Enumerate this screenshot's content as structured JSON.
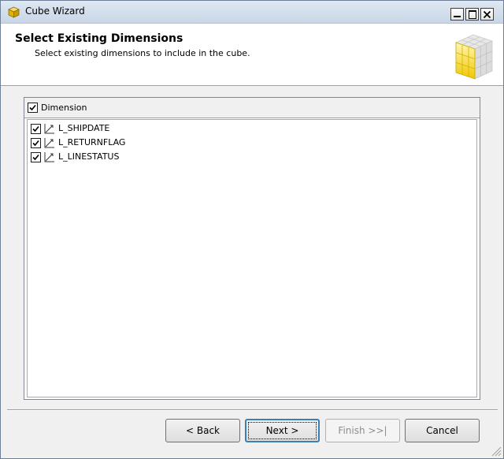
{
  "window": {
    "title": "Cube Wizard"
  },
  "header": {
    "title": "Select Existing Dimensions",
    "subtitle": "Select existing dimensions to include in the cube."
  },
  "list": {
    "column_header": "Dimension",
    "header_checked": true,
    "items": [
      {
        "label": "L_SHIPDATE",
        "checked": true,
        "icon": "dimension-icon"
      },
      {
        "label": "L_RETURNFLAG",
        "checked": true,
        "icon": "dimension-icon"
      },
      {
        "label": "L_LINESTATUS",
        "checked": true,
        "icon": "dimension-icon"
      }
    ]
  },
  "buttons": {
    "back": "< Back",
    "next": "Next >",
    "finish": "Finish >>|",
    "cancel": "Cancel",
    "finish_enabled": false
  },
  "colors": {
    "header_bg": "#ffffff",
    "window_bg": "#f0f0f0",
    "titlebar": "#d5e0ed",
    "cube_yellow": "#f2d000",
    "default_button_border": "#3c7fb1"
  }
}
